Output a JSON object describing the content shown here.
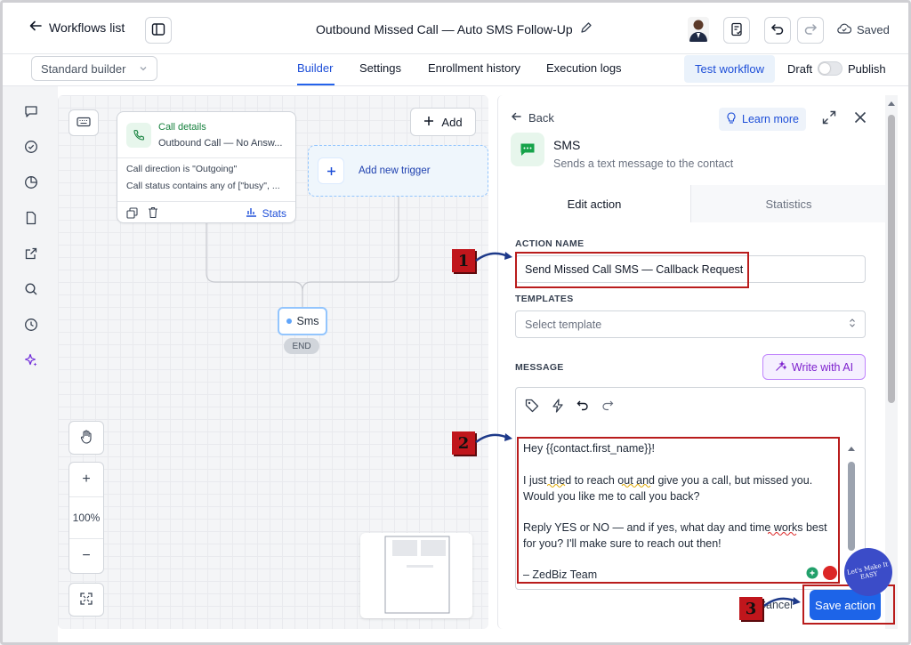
{
  "header": {
    "back_label": "Workflows list",
    "workflow_title": "Outbound Missed Call — Auto SMS Follow-Up",
    "saved_label": "Saved"
  },
  "subbar": {
    "builder_select_value": "Standard builder",
    "tabs": [
      "Builder",
      "Settings",
      "Enrollment history",
      "Execution logs"
    ],
    "active_tab": "Builder",
    "test_button": "Test workflow",
    "draft_label": "Draft",
    "publish_label": "Publish"
  },
  "left_rail": {
    "icons": [
      "chat-bubble-icon",
      "check-circle-icon",
      "pie-chart-icon",
      "document-icon",
      "external-link-icon",
      "search-icon",
      "history-icon",
      "sparkles-icon"
    ]
  },
  "canvas": {
    "add_label": "Add",
    "trigger": {
      "title": "Call details",
      "subtitle": "Outbound Call — No Answ...",
      "conditions": [
        "Call direction is \"Outgoing\"",
        "Call status contains any of [\"busy\", ..."
      ],
      "stats_label": "Stats"
    },
    "add_trigger_label": "Add new trigger",
    "action_node_label": "Sms",
    "end_label": "END",
    "zoom_level": "100%",
    "zoom_in": "+",
    "zoom_out": "−"
  },
  "panel": {
    "back_label": "Back",
    "learn_more_label": "Learn more",
    "action_type_title": "SMS",
    "action_type_description": "Sends a text message to the contact",
    "tabs": [
      "Edit action",
      "Statistics"
    ],
    "action_name_label": "ACTION NAME",
    "action_name_value": "Send Missed Call SMS — Callback Request",
    "templates_label": "TEMPLATES",
    "templates_placeholder": "Select template",
    "message_label": "MESSAGE",
    "write_ai_label": "Write with AI",
    "message_lines": [
      "Hey {{contact.first_name}}!",
      "",
      "I just tried to reach out and give you a call, but missed you.",
      "Would you like me to call you back?",
      "",
      "Reply YES or NO — and if yes, what day and time works best",
      "for you? I'll make sure to reach out then!",
      "",
      "– ZedBiz Team"
    ],
    "cancel_label": "Cancel",
    "save_label": "Save action"
  },
  "annotations": {
    "markers": [
      "1",
      "2",
      "3"
    ],
    "watermark": "Let's Make It EASY"
  },
  "colors": {
    "accent": "#1d64e8",
    "annotation_red": "#b91c1c",
    "ai_purple": "#7e22ce",
    "trigger_green": "#15803d"
  }
}
